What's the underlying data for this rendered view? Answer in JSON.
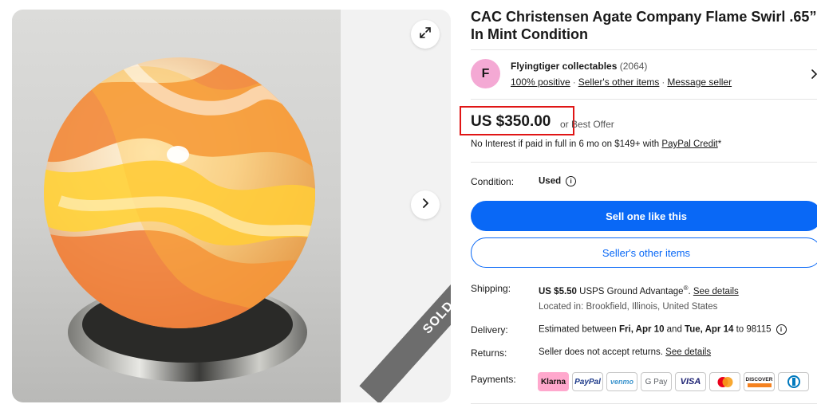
{
  "title": "CAC Christensen Agate Company Flame Swirl .65” In Mint Condition",
  "gallery": {
    "sold_label": "SOLD",
    "expand_icon": "expand-icon",
    "next_icon": "chevron-right-icon"
  },
  "seller": {
    "initial": "F",
    "name": "Flyingtiger collectables",
    "feedback_count": "(2064)",
    "positive": "100% positive",
    "other_items_link": "Seller's other items",
    "message_link": "Message seller"
  },
  "price": {
    "amount": "US $350.00",
    "offer_text": "or Best Offer",
    "interest_prefix": "No Interest if paid in full in 6 mo on $149+ with ",
    "paypal_credit": "PayPal Credit",
    "interest_suffix": "*"
  },
  "condition": {
    "label": "Condition:",
    "value": "Used"
  },
  "buttons": {
    "sell_one": "Sell one like this",
    "sellers_other": "Seller's other items"
  },
  "shipping": {
    "label": "Shipping:",
    "price": "US $5.50",
    "service": " USPS Ground Advantage",
    "reg": "®",
    "dot": ". ",
    "details_link": "See details",
    "location": "Located in: Brookfield, Illinois, United States"
  },
  "delivery": {
    "label": "Delivery:",
    "prefix": "Estimated between ",
    "date1": "Fri, Apr 10",
    "and": " and ",
    "date2": "Tue, Apr 14",
    "suffix": " to 98115"
  },
  "returns": {
    "label": "Returns:",
    "text": "Seller does not accept returns. ",
    "details_link": "See details"
  },
  "payments": {
    "label": "Payments:",
    "methods": [
      "Klarna",
      "PayPal",
      "venmo",
      "G Pay",
      "VISA",
      "Mastercard",
      "DISCOVER",
      "Diners Club"
    ],
    "labels": {
      "klarna": "Klarna",
      "paypal": "PayPal",
      "venmo": "venmo",
      "gpay": "G Pay",
      "visa": "VISA",
      "discover": "DISCOVER"
    }
  },
  "colors": {
    "primary_blue": "#0968f6",
    "highlight_red": "#e01515",
    "avatar_pink": "#f4a9d4",
    "sold_band": "#6d6d6d"
  }
}
